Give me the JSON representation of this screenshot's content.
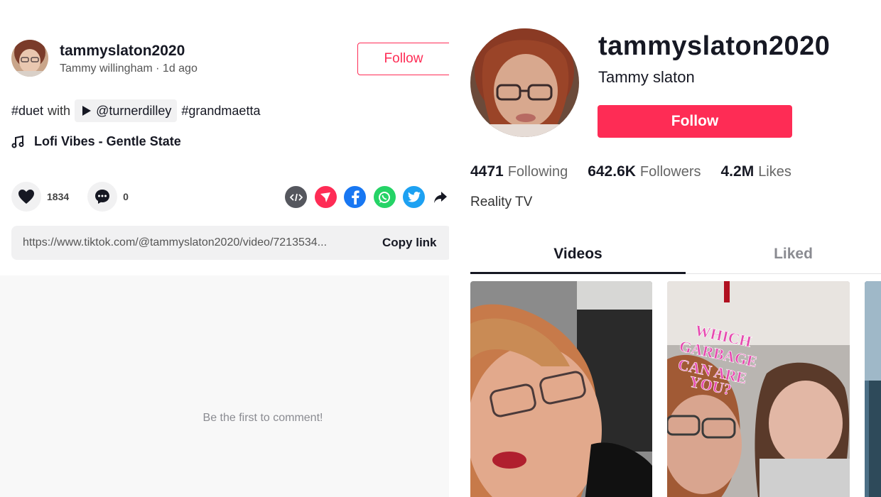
{
  "post": {
    "author_handle": "tammyslaton2020",
    "author_sub": "Tammy willingham · 1d ago",
    "follow_label": "Follow",
    "desc_hashtag1": "#duet",
    "desc_with": "with",
    "duet_user": "@turnerdilley",
    "desc_hashtag2": "#grandmaetta",
    "music_title": "Lofi Vibes - Gentle State",
    "likes": "1834",
    "comments": "0",
    "share_icons": [
      "embed-icon",
      "send-icon",
      "facebook-icon",
      "whatsapp-icon",
      "twitter-icon",
      "share-arrow-icon"
    ],
    "link_url": "https://www.tiktok.com/@tammyslaton2020/video/7213534...",
    "copy_label": "Copy link",
    "empty_comments": "Be the first to comment!"
  },
  "profile": {
    "handle": "tammyslaton2020",
    "name": "Tammy slaton",
    "follow_label": "Follow",
    "following_count": "4471",
    "following_label": "Following",
    "followers_count": "642.6K",
    "followers_label": "Followers",
    "likes_count": "4.2M",
    "likes_label": "Likes",
    "bio": "Reality TV",
    "tabs": [
      "Videos",
      "Liked"
    ],
    "thumb2_overlay": [
      "WHICH",
      "GARBAGE",
      "CAN ARE",
      "YOU?"
    ]
  },
  "colors": {
    "accent": "#fe2c55",
    "text": "#161823",
    "muted": "#8a8b91",
    "facebook": "#1877f2",
    "whatsapp": "#25d366",
    "twitter": "#1da1f2",
    "embed": "#55575e"
  }
}
